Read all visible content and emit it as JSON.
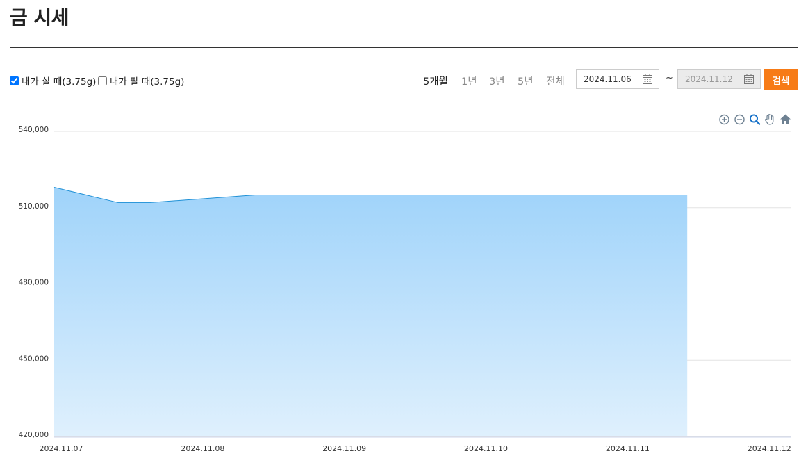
{
  "page": {
    "title": "금 시세"
  },
  "controls": {
    "buy_label": "내가 살 때(3.75g)",
    "buy_checked": true,
    "sell_label": "내가 팔 때(3.75g)",
    "sell_checked": false,
    "periods": [
      {
        "label": "5개월",
        "active": true
      },
      {
        "label": "1년",
        "active": false
      },
      {
        "label": "3년",
        "active": false
      },
      {
        "label": "5년",
        "active": false
      },
      {
        "label": "전체",
        "active": false
      }
    ],
    "start_date": "2024.11.06",
    "separator": "~",
    "end_date": "2024.11.12",
    "search_label": "검색"
  },
  "toolbar": {
    "icons": [
      "zoom-in-icon",
      "zoom-out-icon",
      "magnifier-icon",
      "pan-hand-icon",
      "home-icon"
    ]
  },
  "colors": {
    "accent": "#f77b16",
    "series_line": "#1e90d6",
    "area_top": "#9fd3fa",
    "area_bottom": "#dff0fd"
  },
  "chart_data": {
    "type": "area",
    "title": "",
    "xlabel": "",
    "ylabel": "",
    "x_ticks": [
      "2024.11.07",
      "2024.11.08",
      "2024.11.09",
      "2024.11.10",
      "2024.11.11",
      "2024.11.12"
    ],
    "y_ticks": [
      "420,000",
      "450,000",
      "480,000",
      "510,000",
      "540,000"
    ],
    "ylim": [
      420000,
      540000
    ],
    "xlim": [
      0,
      5.2
    ],
    "grid": true,
    "series": [
      {
        "x": [
          0,
          0.45,
          0.68,
          1.42,
          4.47
        ],
        "values": [
          518000,
          512000,
          512000,
          515000,
          515000
        ]
      }
    ]
  }
}
